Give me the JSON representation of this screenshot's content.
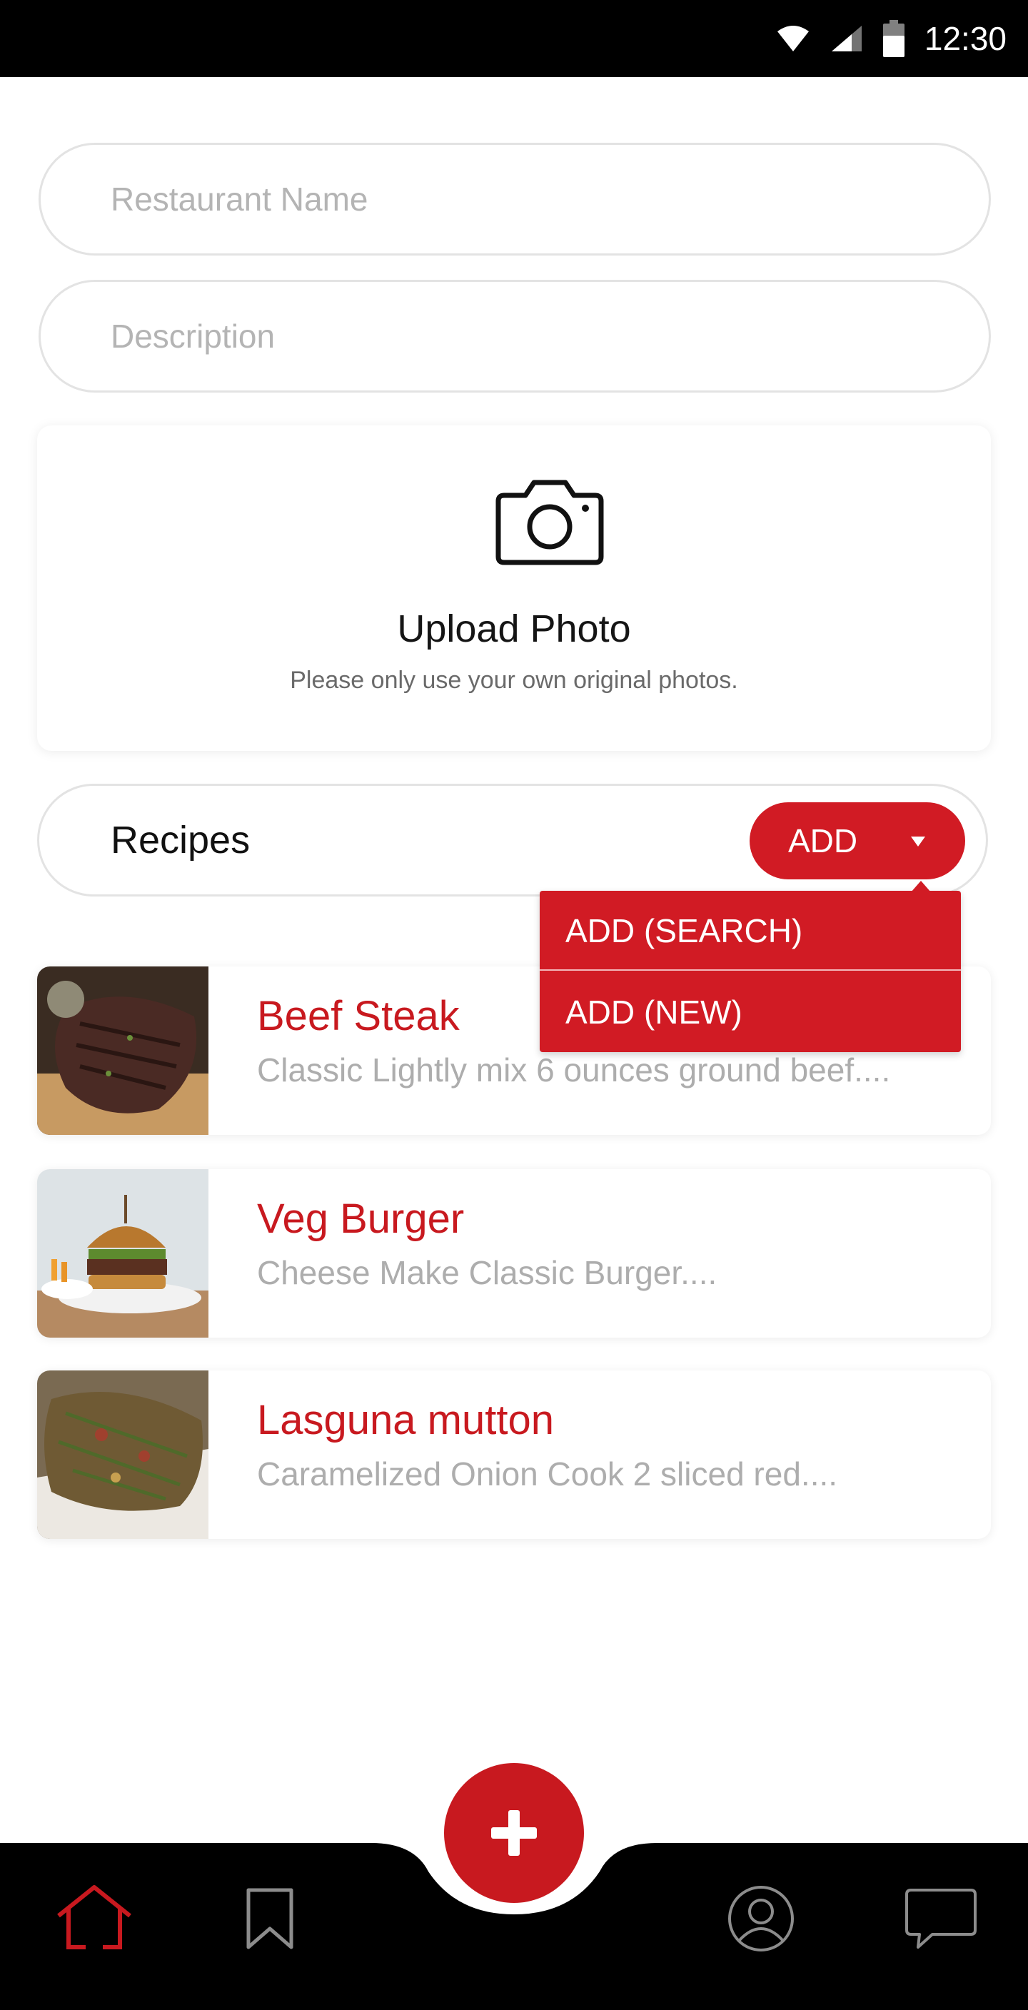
{
  "status_bar": {
    "time": "12:30",
    "icons": [
      "wifi-icon",
      "signal-icon",
      "battery-icon"
    ]
  },
  "form": {
    "restaurant_name": {
      "value": "",
      "placeholder": "Restaurant Name"
    },
    "description": {
      "value": "",
      "placeholder": "Description"
    }
  },
  "upload": {
    "icon": "camera-icon",
    "title": "Upload Photo",
    "subtitle": "Please only use your own original photos."
  },
  "recipes_section": {
    "label": "Recipes",
    "add_button_label": "ADD",
    "dropdown_items": [
      {
        "label": "ADD (SEARCH)"
      },
      {
        "label": "ADD (NEW)"
      }
    ]
  },
  "recipes": [
    {
      "title": "Beef Steak",
      "description": "Classic Lightly mix 6 ounces ground beef....",
      "image": "beef-steak-photo"
    },
    {
      "title": "Veg Burger",
      "description": "Cheese Make Classic Burger....",
      "image": "veg-burger-photo"
    },
    {
      "title": "Lasguna mutton",
      "description": "Caramelized Onion Cook 2 sliced red....",
      "image": "lasguna-mutton-photo"
    }
  ],
  "bottom_nav": {
    "items": [
      "home-icon",
      "bookmark-icon",
      "add-icon",
      "profile-icon",
      "chat-icon"
    ],
    "active": "home-icon"
  },
  "colors": {
    "accent": "#c8191f",
    "dropdown": "#d11b24",
    "nav_background": "#000000",
    "placeholder": "#b4b4b4"
  }
}
